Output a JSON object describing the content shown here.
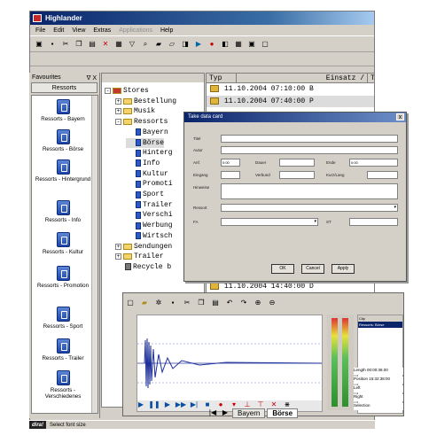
{
  "app": {
    "title": "Highlander"
  },
  "menu": [
    "File",
    "Edit",
    "View",
    "Extras",
    "Applications",
    "Help"
  ],
  "favourites": {
    "header": "Favourites",
    "pin": "ᐁ X",
    "tab": "Ressorts",
    "items": [
      "Ressorts - Bayern",
      "Ressorts - Börse",
      "Ressorts - Hintergrund",
      "Ressorts - Info",
      "Ressorts - Kultur",
      "Ressorts - Promotion",
      "Ressorts - Sport",
      "Ressorts - Trailer",
      "Ressorts - Verschiedenes"
    ]
  },
  "tree": {
    "nodes": [
      {
        "label": "Stores",
        "level": 0,
        "expander": "-"
      },
      {
        "label": "Bestellung",
        "level": 1,
        "expander": "+"
      },
      {
        "label": "Musik",
        "level": 1,
        "expander": "+"
      },
      {
        "label": "Ressorts",
        "level": 1,
        "expander": "-"
      },
      {
        "label": "Bayern",
        "level": 2
      },
      {
        "label": "Börse",
        "level": 2
      },
      {
        "label": "Hinterg",
        "level": 2
      },
      {
        "label": "Info",
        "level": 2
      },
      {
        "label": "Kultur",
        "level": 2
      },
      {
        "label": "Promoti",
        "level": 2
      },
      {
        "label": "Sport",
        "level": 2
      },
      {
        "label": "Trailer",
        "level": 2
      },
      {
        "label": "Verschi",
        "level": 2
      },
      {
        "label": "Werbung",
        "level": 2
      },
      {
        "label": "Wirtsch",
        "level": 2
      },
      {
        "label": "Sendungen",
        "level": 1,
        "expander": "+"
      },
      {
        "label": "Trailer",
        "level": 1,
        "expander": "+"
      },
      {
        "label": "Recycle b",
        "level": 1
      }
    ]
  },
  "list": {
    "columns": [
      "Typ",
      "Einsatz /",
      "T"
    ],
    "rows": [
      "11.10.2004 07:10:00 B",
      "11.10.2004 07:40:00 P"
    ],
    "bottom_row": "11.10.2004 14:40:00 D"
  },
  "dialog": {
    "title": "Take data card",
    "close": "x",
    "fields": {
      "titel": "Titel",
      "autor": "Autor",
      "anf": "Anf.",
      "anf_val": "0:00",
      "dauer": "Dauer",
      "ende": "Ende",
      "ende_val": "0:00",
      "eingang": "Eingang",
      "verbund": "Verbund",
      "kurz_lang": "Kurz/Lang",
      "hinweise": "Hinweise",
      "ressort": "Ressort",
      "fa": "FA",
      "st": "ST"
    },
    "buttons": [
      "OK",
      "Cancel",
      "Apply"
    ]
  },
  "audio": {
    "clip_header": "Clip",
    "clip_selected": "Ressorts: Börse",
    "controls": [
      "Length",
      "Position",
      "Left",
      "Right",
      "Selection"
    ],
    "values": [
      "00:00:38.00",
      "15:32:38:00",
      "",
      "",
      ""
    ]
  },
  "tabs": [
    "Bayern",
    "Börse"
  ],
  "status": {
    "logo": "dira!",
    "text": "Select font size"
  }
}
